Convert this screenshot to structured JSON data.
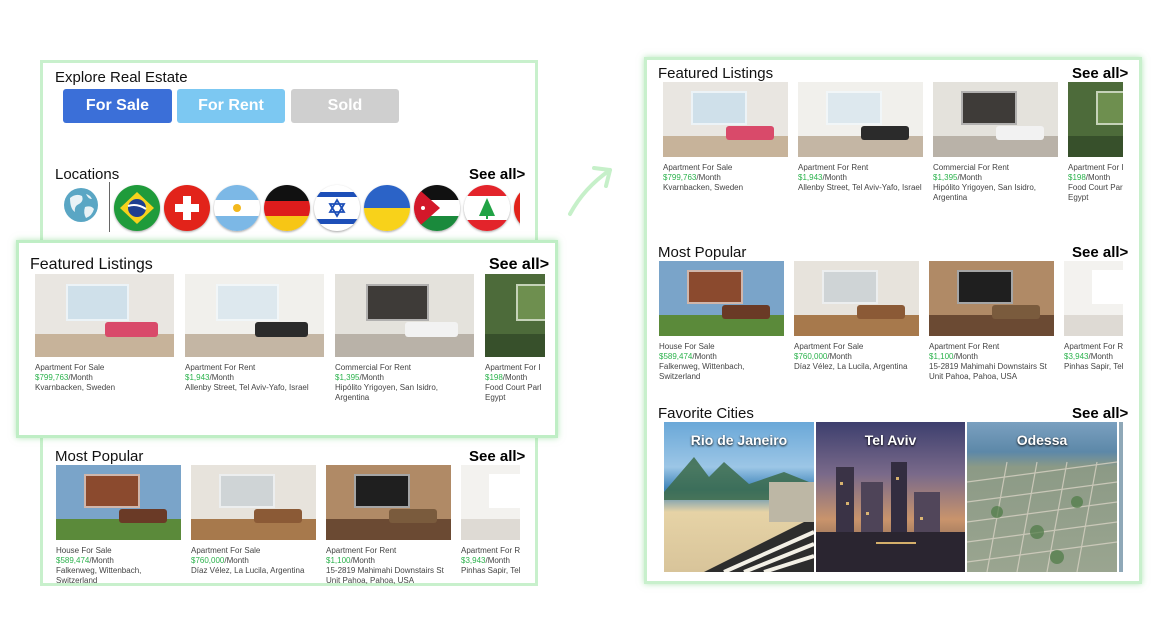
{
  "left": {
    "explore_title": "Explore Real Estate",
    "buttons": [
      "For Sale",
      "For Rent",
      "Sold"
    ],
    "locations_title": "Locations",
    "see_all": "See all>",
    "flags": [
      "globe",
      "brazil",
      "switzerland",
      "argentina",
      "germany",
      "israel",
      "ukraine",
      "jordan",
      "lebanon"
    ],
    "featured_title": "Featured Listings",
    "popular_title": "Most Popular"
  },
  "right": {
    "featured_title": "Featured Listings",
    "popular_title": "Most Popular",
    "cities_title": "Favorite Cities",
    "see_all": "See all>"
  },
  "featured": [
    {
      "type": "Apartment For Sale",
      "price": "$799,763",
      "per": "/Month",
      "addr1": "Kvarnbacken, Sweden",
      "addr2": ""
    },
    {
      "type": "Apartment For Rent",
      "price": "$1,943",
      "per": "/Month",
      "addr1": "Allenby Street, Tel Aviv-Yafo, Israel",
      "addr2": ""
    },
    {
      "type": "Commercial For Rent",
      "price": "$1,395",
      "per": "/Month",
      "addr1": "Hipólito Yrigoyen, San Isidro,",
      "addr2": "Argentina"
    },
    {
      "type": "Apartment For I",
      "price": "$198",
      "per": "/Month",
      "addr1": "Food Court Parl",
      "addr2": "Egypt"
    }
  ],
  "popular": [
    {
      "type": "House For Sale",
      "price": "$589,474",
      "per": "/Month",
      "addr1": "Falkenweg, Wittenbach,",
      "addr2": "Switzerland"
    },
    {
      "type": "Apartment For Sale",
      "price": "$760,000",
      "per": "/Month",
      "addr1": "Díaz Vélez, La Lucila, Argentina",
      "addr2": ""
    },
    {
      "type": "Apartment For Rent",
      "price": "$1,100",
      "per": "/Month",
      "addr1": "15-2819 Mahimahi Downstairs St",
      "addr2": "Unit Pahoa, Pahoa, USA"
    },
    {
      "type": "Apartment For Re",
      "price": "$3,943",
      "per": "/Month",
      "addr1": "Pinhas Sapir, Tel",
      "addr2": ""
    }
  ],
  "cities": [
    "Rio de Janeiro",
    "Tel Aviv",
    "Odessa"
  ],
  "colors": {
    "for_sale": "#3b6fd8",
    "for_rent": "#7cc8f2",
    "sold": "#cfcfcf",
    "price": "#2bb24c",
    "panel_border": "#c8f0cc"
  }
}
